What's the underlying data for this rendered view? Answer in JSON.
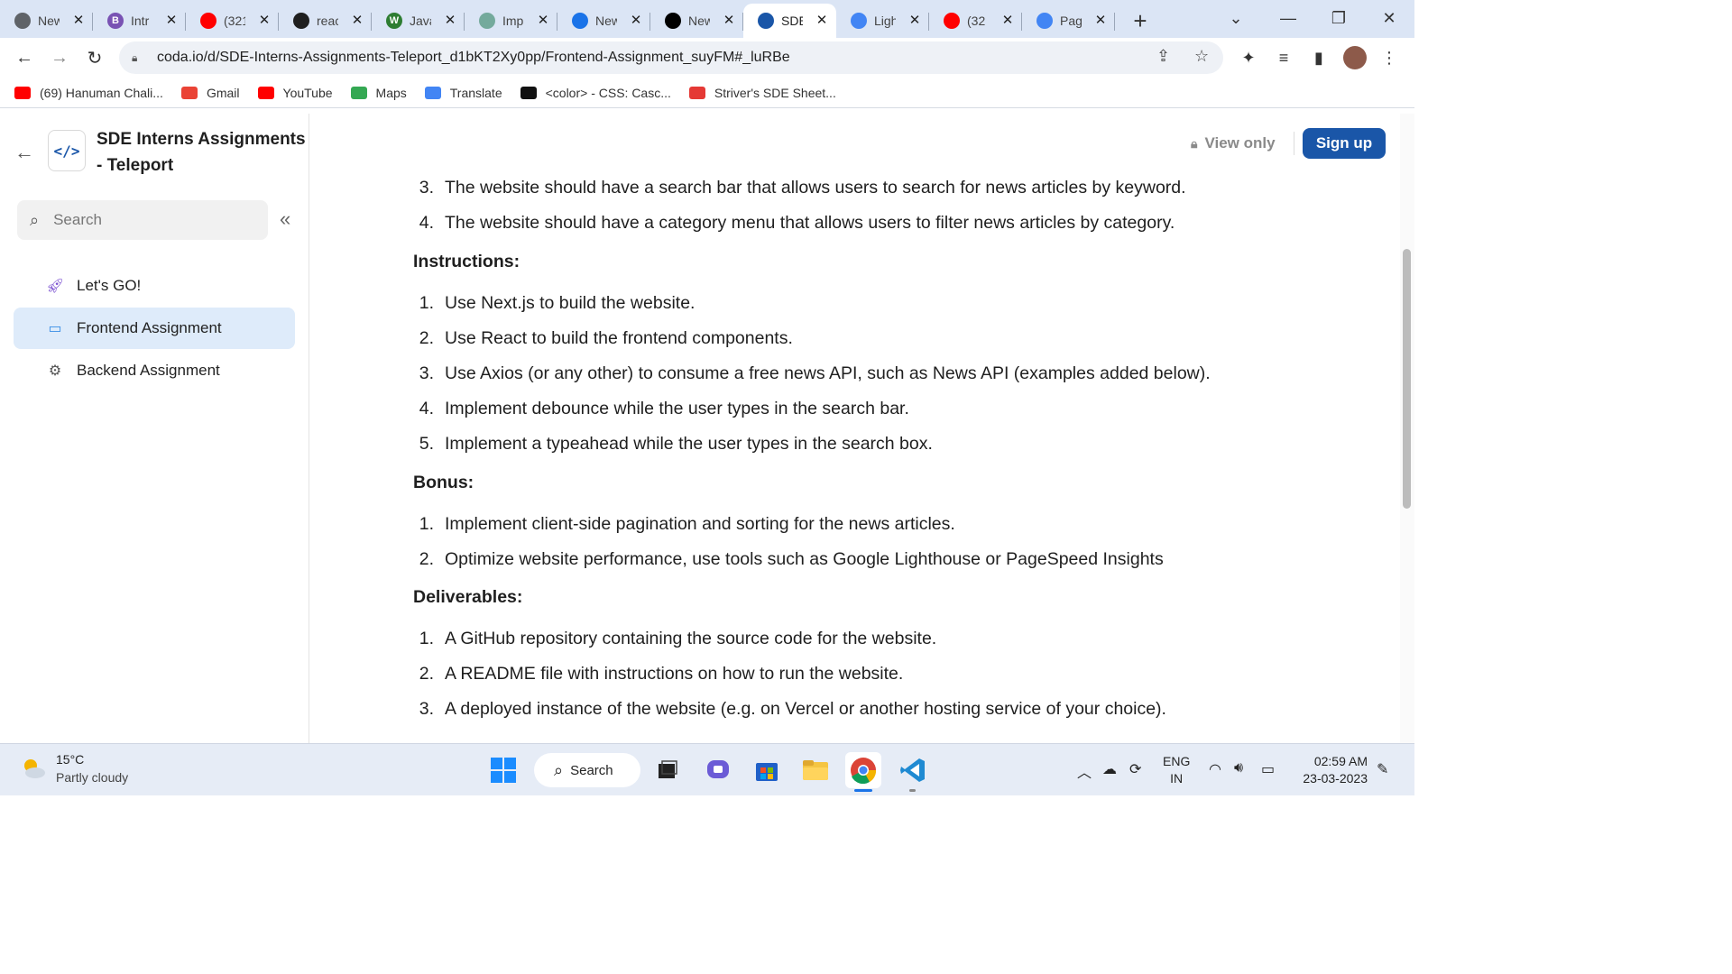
{
  "browser": {
    "tabs": [
      {
        "title": "New",
        "favicon_color": "#5f6368",
        "icon": "chrome-icon"
      },
      {
        "title": "Intr",
        "favicon_color": "#7952b3",
        "icon": "bootstrap-icon",
        "letter": "B"
      },
      {
        "title": "(321",
        "favicon_color": "#ff0000",
        "icon": "youtube-icon"
      },
      {
        "title": "reac",
        "favicon_color": "#1f1f1f",
        "icon": "github-icon"
      },
      {
        "title": "Java",
        "favicon_color": "#2e7d32",
        "icon": "w3schools-icon",
        "letter": "W"
      },
      {
        "title": "Imp",
        "favicon_color": "#74aa9c",
        "icon": "chatgpt-icon"
      },
      {
        "title": "New",
        "favicon_color": "#1a73e8",
        "icon": "docs-icon"
      },
      {
        "title": "New",
        "favicon_color": "#000000",
        "icon": "triangle-icon"
      },
      {
        "title": "SDE",
        "favicon_color": "#1a56a8",
        "icon": "code-icon",
        "active": true
      },
      {
        "title": "Ligh",
        "favicon_color": "#4285f4",
        "icon": "google-chrome-icon"
      },
      {
        "title": "(32",
        "favicon_color": "#ff0000",
        "icon": "youtube-icon"
      },
      {
        "title": "Pag",
        "favicon_color": "#4285f4",
        "icon": "pagespeed-icon"
      }
    ],
    "url": "coda.io/d/SDE-Interns-Assignments-Teleport_d1bKT2Xy0pp/Frontend-Assignment_suyFM#_luRBe",
    "bookmarks": [
      {
        "label": "(69) Hanuman Chali...",
        "color": "#ff0000"
      },
      {
        "label": "Gmail",
        "color": "#ea4335"
      },
      {
        "label": "YouTube",
        "color": "#ff0000"
      },
      {
        "label": "Maps",
        "color": "#34a853"
      },
      {
        "label": "Translate",
        "color": "#4285f4"
      },
      {
        "label": "<color> - CSS: Casc...",
        "color": "#111111"
      },
      {
        "label": "Striver's SDE Sheet...",
        "color": "#e53935"
      }
    ]
  },
  "doc": {
    "title": "SDE Interns  Assignments - Teleport",
    "search_placeholder": "Search",
    "nav": [
      {
        "label": "Let's GO!",
        "icon": "rocket-icon"
      },
      {
        "label": "Frontend Assignment",
        "icon": "monitor-icon",
        "selected": true
      },
      {
        "label": "Backend Assignment",
        "icon": "api-gear-icon"
      }
    ],
    "view_only": "View only",
    "sign_up": "Sign up"
  },
  "content": {
    "top_items": [
      {
        "n": "3.",
        "text": "The website should have a search bar that allows users to search for news articles by keyword."
      },
      {
        "n": "4.",
        "text": "The website should have a category menu that allows users to filter news articles by category."
      }
    ],
    "instructions_heading": "Instructions:",
    "instructions": [
      {
        "n": "1.",
        "text": "Use Next.js to build the website."
      },
      {
        "n": "2.",
        "text": "Use React to build the frontend components."
      },
      {
        "n": "3.",
        "text": "Use Axios (or any other) to consume a free news API, such as News API (examples added below)."
      },
      {
        "n": "4.",
        "text": "Implement debounce while the user types in the search bar."
      },
      {
        "n": "5.",
        "text": "Implement a typeahead while the user types in the search box."
      }
    ],
    "bonus_heading": "Bonus:",
    "bonus": [
      {
        "n": "1.",
        "text": "Implement client-side pagination and sorting for the news articles."
      },
      {
        "n": "2.",
        "text": "Optimize website performance, use tools such as Google Lighthouse or PageSpeed Insights"
      }
    ],
    "deliverables_heading": "Deliverables:",
    "deliverables": [
      {
        "n": "1.",
        "text": "A GitHub repository containing the source code for the website."
      },
      {
        "n": "2.",
        "text": "A README file with instructions on how to run the website."
      },
      {
        "n": "3.",
        "text": "A deployed instance of the website (e.g. on Vercel or another hosting service of your choice)."
      }
    ]
  },
  "taskbar": {
    "temperature": "15°C",
    "condition": "Partly cloudy",
    "search_label": "Search",
    "lang_line1": "ENG",
    "lang_line2": "IN",
    "time": "02:59 AM",
    "date": "23-03-2023"
  }
}
